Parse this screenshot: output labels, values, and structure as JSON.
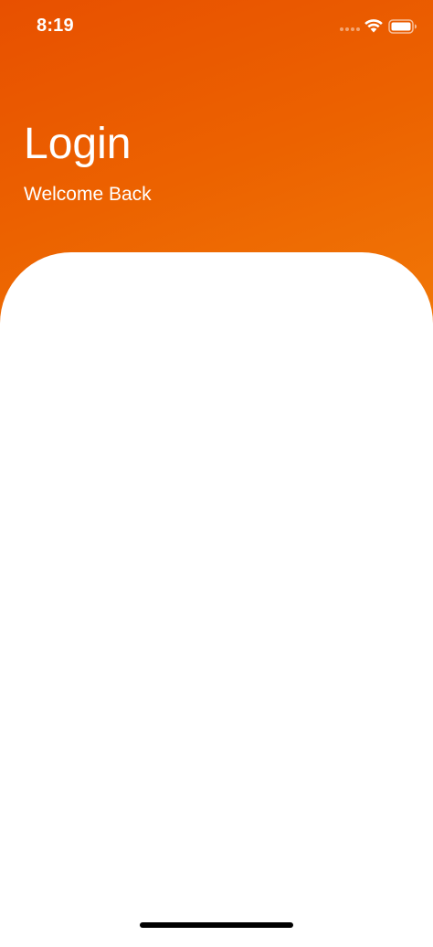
{
  "status_bar": {
    "time": "8:19",
    "icons": [
      "signal-dots-icon",
      "wifi-icon",
      "battery-icon"
    ]
  },
  "header": {
    "title": "Login",
    "subtitle": "Welcome Back"
  },
  "colors": {
    "header_gradient_start": "#e85000",
    "header_gradient_end": "#f27c08",
    "card_background": "#ffffff",
    "text_on_header": "#ffffff"
  }
}
